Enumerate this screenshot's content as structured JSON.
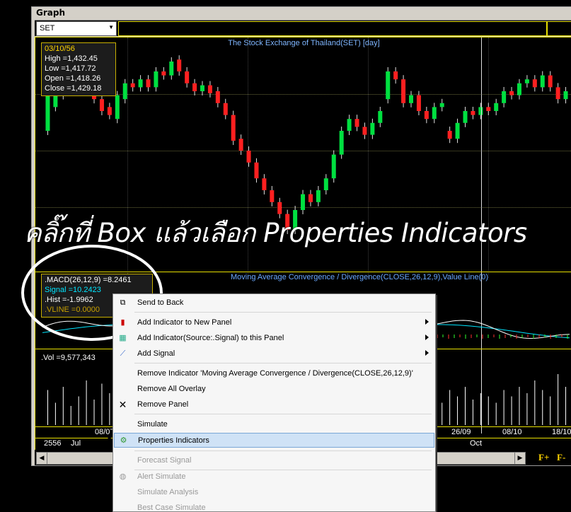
{
  "window": {
    "title": "Graph"
  },
  "toolbar": {
    "symbol": "SET"
  },
  "price_panel": {
    "title": "The Stock Exchange of Thailand(SET) [day]",
    "info": {
      "date": "03/10/56",
      "high": "High =1,432.45",
      "low": "Low  =1,417.72",
      "open": "Open =1,418.26",
      "close": "Close =1,429.18"
    },
    "candles": [
      {
        "o": 0.6,
        "c": 0.8,
        "up": true
      },
      {
        "o": 0.72,
        "c": 0.85,
        "up": true
      },
      {
        "o": 0.78,
        "c": 0.86,
        "up": true
      },
      {
        "o": 0.84,
        "c": 0.82,
        "up": false
      },
      {
        "o": 0.83,
        "c": 0.88,
        "up": true
      },
      {
        "o": 0.86,
        "c": 0.8,
        "up": false
      },
      {
        "o": 0.8,
        "c": 0.76,
        "up": false
      },
      {
        "o": 0.76,
        "c": 0.7,
        "up": false
      },
      {
        "o": 0.72,
        "c": 0.68,
        "up": false
      },
      {
        "o": 0.66,
        "c": 0.78,
        "up": true
      },
      {
        "o": 0.76,
        "c": 0.84,
        "up": true
      },
      {
        "o": 0.84,
        "c": 0.82,
        "up": false
      },
      {
        "o": 0.82,
        "c": 0.86,
        "up": true
      },
      {
        "o": 0.86,
        "c": 0.82,
        "up": false
      },
      {
        "o": 0.82,
        "c": 0.9,
        "up": true
      },
      {
        "o": 0.9,
        "c": 0.88,
        "up": false
      },
      {
        "o": 0.88,
        "c": 0.95,
        "up": true
      },
      {
        "o": 0.96,
        "c": 0.9,
        "up": false
      },
      {
        "o": 0.9,
        "c": 0.84,
        "up": false
      },
      {
        "o": 0.84,
        "c": 0.8,
        "up": false
      },
      {
        "o": 0.8,
        "c": 0.83,
        "up": true
      },
      {
        "o": 0.83,
        "c": 0.79,
        "up": false
      },
      {
        "o": 0.8,
        "c": 0.74,
        "up": false
      },
      {
        "o": 0.74,
        "c": 0.68,
        "up": false
      },
      {
        "o": 0.68,
        "c": 0.55,
        "up": false
      },
      {
        "o": 0.56,
        "c": 0.5,
        "up": false
      },
      {
        "o": 0.5,
        "c": 0.44,
        "up": false
      },
      {
        "o": 0.44,
        "c": 0.36,
        "up": false
      },
      {
        "o": 0.36,
        "c": 0.3,
        "up": false
      },
      {
        "o": 0.3,
        "c": 0.24,
        "up": false
      },
      {
        "o": 0.24,
        "c": 0.18,
        "up": false
      },
      {
        "o": 0.18,
        "c": 0.1,
        "up": false
      },
      {
        "o": 0.1,
        "c": 0.2,
        "up": true
      },
      {
        "o": 0.2,
        "c": 0.28,
        "up": true
      },
      {
        "o": 0.28,
        "c": 0.24,
        "up": false
      },
      {
        "o": 0.24,
        "c": 0.3,
        "up": true
      },
      {
        "o": 0.3,
        "c": 0.36,
        "up": true
      },
      {
        "o": 0.36,
        "c": 0.48,
        "up": true
      },
      {
        "o": 0.48,
        "c": 0.6,
        "up": true
      },
      {
        "o": 0.6,
        "c": 0.66,
        "up": true
      },
      {
        "o": 0.66,
        "c": 0.62,
        "up": false
      },
      {
        "o": 0.62,
        "c": 0.58,
        "up": false
      },
      {
        "o": 0.58,
        "c": 0.64,
        "up": true
      },
      {
        "o": 0.64,
        "c": 0.7,
        "up": true
      },
      {
        "o": 0.76,
        "c": 0.9,
        "up": true
      },
      {
        "o": 0.9,
        "c": 0.86,
        "up": false
      },
      {
        "o": 0.86,
        "c": 0.74,
        "up": false
      },
      {
        "o": 0.74,
        "c": 0.78,
        "up": true
      },
      {
        "o": 0.78,
        "c": 0.7,
        "up": false
      },
      {
        "o": 0.7,
        "c": 0.66,
        "up": false
      },
      {
        "o": 0.66,
        "c": 0.72,
        "up": true
      },
      {
        "o": 0.72,
        "c": 0.74,
        "up": true
      },
      {
        "o": 0.6,
        "c": 0.56,
        "up": false
      },
      {
        "o": 0.56,
        "c": 0.64,
        "up": true
      },
      {
        "o": 0.64,
        "c": 0.7,
        "up": true
      },
      {
        "o": 0.7,
        "c": 0.68,
        "up": false
      },
      {
        "o": 0.68,
        "c": 0.72,
        "up": true
      },
      {
        "o": 0.72,
        "c": 0.7,
        "up": false
      },
      {
        "o": 0.7,
        "c": 0.74,
        "up": true
      },
      {
        "o": 0.74,
        "c": 0.8,
        "up": true
      },
      {
        "o": 0.8,
        "c": 0.78,
        "up": false
      },
      {
        "o": 0.78,
        "c": 0.84,
        "up": true
      },
      {
        "o": 0.84,
        "c": 0.86,
        "up": true
      },
      {
        "o": 0.86,
        "c": 0.82,
        "up": false
      },
      {
        "o": 0.82,
        "c": 0.88,
        "up": true
      },
      {
        "o": 0.88,
        "c": 0.82,
        "up": false
      },
      {
        "o": 0.82,
        "c": 0.76,
        "up": false
      },
      {
        "o": 0.76,
        "c": 0.8,
        "up": true
      }
    ]
  },
  "macd_panel": {
    "title": "Moving Average Convergence / Divergence(CLOSE,26,12,9),Value Line(0)",
    "macd": ".MACD(26,12,9)    =8.2461",
    "signal": "Signal  =10.2423",
    "hist": ".Hist  =-1.9962",
    "vline": ".VLINE   =0.0000",
    "colors": {
      "macd": "#ffffff",
      "signal": "#00e5ff",
      "hist": "#ffffff",
      "vline": "#c8a000"
    }
  },
  "volume_panel": {
    "label": ".Vol   =9,577,343",
    "bars": [
      0.55,
      0.35,
      0.6,
      0.3,
      0.45,
      0.7,
      0.4,
      0.65,
      0.5,
      0.35,
      0.55,
      0.75,
      0.45,
      0.4,
      0.6,
      0.35,
      0.5,
      0.3,
      0.45,
      0.4,
      0.55,
      0.7,
      0.5,
      0.6,
      0.45,
      0.35,
      0.5,
      0.4,
      0.3,
      0.55,
      0.45,
      0.6,
      0.5,
      0.35,
      0.4,
      0.55,
      0.45,
      0.35,
      0.5,
      0.4,
      0.6,
      0.45,
      0.3,
      0.35,
      0.5,
      0.4,
      0.55,
      0.65,
      0.45,
      0.5,
      0.4,
      0.35,
      0.55,
      0.45,
      0.6,
      0.4,
      0.5,
      0.45,
      0.35,
      0.55,
      0.45,
      0.6,
      0.5,
      0.7,
      0.55,
      0.45,
      0.8,
      0.6
    ]
  },
  "dates": {
    "d1": "08/07",
    "d2": "26/09",
    "d3": "08/10",
    "d4": "18/10",
    "year": "2556",
    "month1": "Jul",
    "month2": "Oct"
  },
  "bottom": {
    "f_plus": "F+",
    "f_minus": "F-"
  },
  "overlay_caption": "คลิ๊กที่ Box แล้วเลือก Properties Indicators",
  "context_menu": {
    "send_back": "Send to Back",
    "add_indicator_new_panel": "Add Indicator to New Panel",
    "add_indicator_source": "Add Indicator(Source:.Signal) to this Panel",
    "add_signal": "Add Signal",
    "remove_indicator": "Remove Indicator 'Moving Average Convergence / Divergence(CLOSE,26,12,9)'",
    "remove_all_overlay": "Remove All Overlay",
    "remove_panel": "Remove Panel",
    "simulate": "Simulate",
    "properties_indicators": "Properties Indicators",
    "forecast_signal": "Forecast Signal",
    "alert_simulate": "Alert Simulate",
    "simulate_analysis": "Simulate Analysis",
    "best_case_simulate": "Best Case Simulate"
  }
}
